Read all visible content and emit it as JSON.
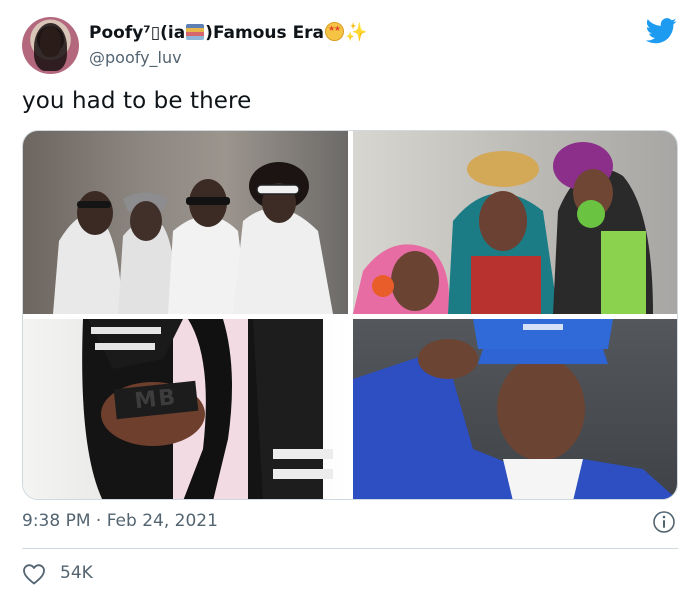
{
  "author": {
    "display_name_prefix": "Poofy⁷▯(ia",
    "display_name_suffix": ")Famous Era",
    "emojis": [
      "books-emoji",
      "star-struck-emoji",
      "sparkles-emoji"
    ],
    "handle": "@poofy_luv"
  },
  "tweet": {
    "text": "you had to be there",
    "photos": [
      {
        "name": "group-photo-boys"
      },
      {
        "name": "group-photo-girls"
      },
      {
        "name": "ring-hand-photo",
        "ring_text": "MB"
      },
      {
        "name": "boy-with-cap-photo"
      }
    ],
    "timestamp": "9:38 PM · Feb 24, 2021",
    "likes": "54K"
  },
  "colors": {
    "twitter_blue": "#1d9bf0",
    "secondary_text": "#536471",
    "border": "#cfd9de"
  }
}
